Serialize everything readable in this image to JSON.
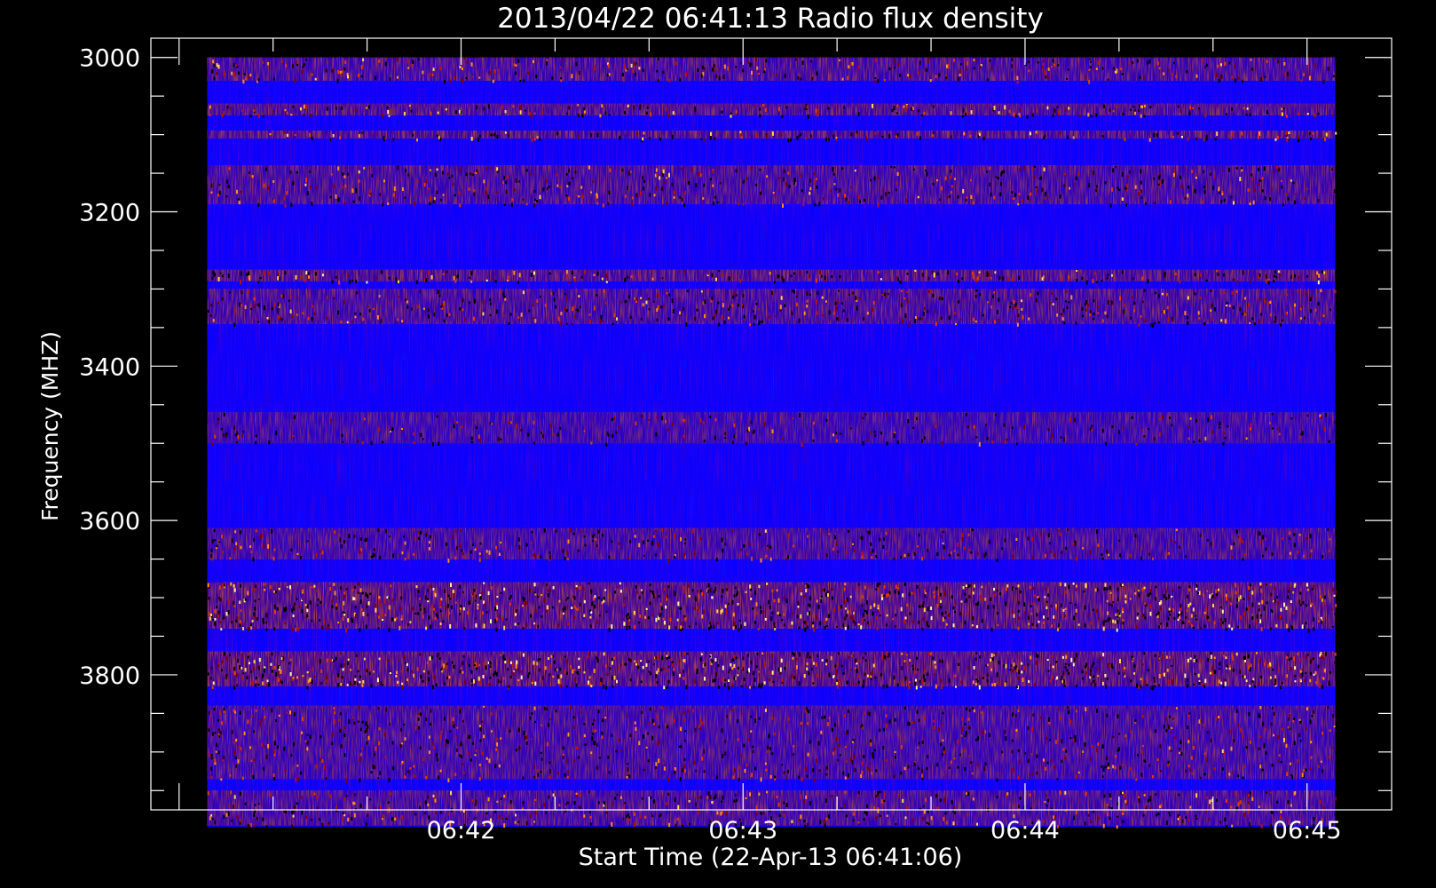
{
  "chart_data": {
    "type": "heatmap",
    "title": "2013/04/22 06:41:13 Radio flux density",
    "xlabel": "Start Time (22-Apr-13 06:41:06)",
    "ylabel": "Frequency (MHZ)",
    "x_ticks": [
      {
        "time_sec": 66,
        "label": "06:42"
      },
      {
        "time_sec": 126,
        "label": "06:43"
      },
      {
        "time_sec": 186,
        "label": "06:44"
      },
      {
        "time_sec": 246,
        "label": "06:45"
      }
    ],
    "y_ticks": [
      {
        "freq": 3000,
        "label": "3000"
      },
      {
        "freq": 3200,
        "label": "3200"
      },
      {
        "freq": 3400,
        "label": "3400"
      },
      {
        "freq": 3600,
        "label": "3600"
      },
      {
        "freq": 3800,
        "label": "3800"
      }
    ],
    "xlim_sec": [
      0,
      264
    ],
    "ylim": [
      3975,
      2975
    ],
    "image_extent": {
      "t_start_sec": 12,
      "t_end_sec": 252,
      "f_start": 3000,
      "f_end": 3997
    },
    "colormap": [
      "#000000",
      "#1a0000",
      "#7f0000",
      "#d22000",
      "#ff8a1a",
      "#ffe060",
      "#ffffff",
      "#0000ff"
    ],
    "background_color": "#0a00ff",
    "bands": [
      {
        "f_start": 3000,
        "f_end": 3030,
        "intensity": 0.55
      },
      {
        "f_start": 3060,
        "f_end": 3075,
        "intensity": 0.7
      },
      {
        "f_start": 3095,
        "f_end": 3105,
        "intensity": 0.75
      },
      {
        "f_start": 3140,
        "f_end": 3190,
        "intensity": 0.5
      },
      {
        "f_start": 3275,
        "f_end": 3290,
        "intensity": 0.75
      },
      {
        "f_start": 3300,
        "f_end": 3345,
        "intensity": 0.55
      },
      {
        "f_start": 3460,
        "f_end": 3500,
        "intensity": 0.3
      },
      {
        "f_start": 3610,
        "f_end": 3650,
        "intensity": 0.45
      },
      {
        "f_start": 3680,
        "f_end": 3740,
        "intensity": 0.95
      },
      {
        "f_start": 3770,
        "f_end": 3815,
        "intensity": 1.0
      },
      {
        "f_start": 3840,
        "f_end": 3935,
        "intensity": 0.45
      },
      {
        "f_start": 3950,
        "f_end": 3995,
        "intensity": 0.55
      }
    ]
  }
}
